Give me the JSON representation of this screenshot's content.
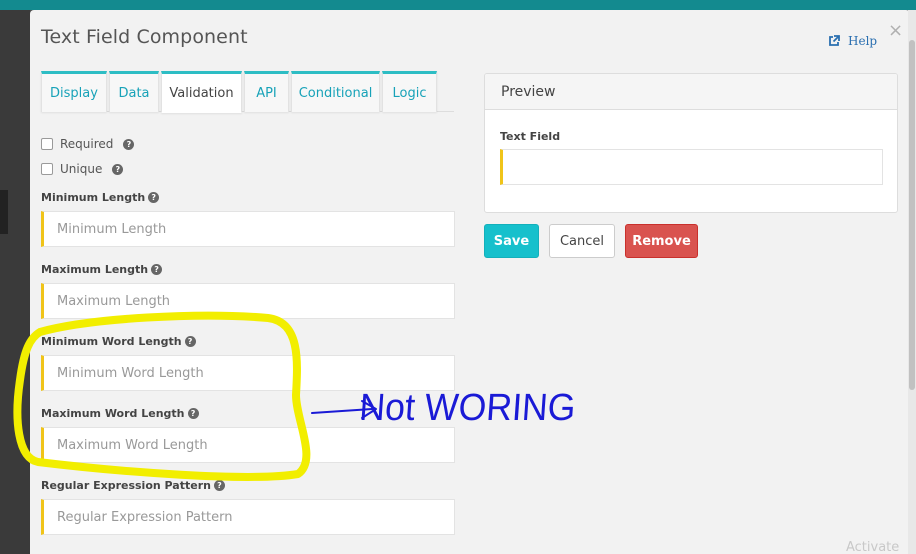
{
  "modal": {
    "title": "Text Field Component",
    "close_label": "×",
    "help_label": "Help"
  },
  "tabs": [
    {
      "label": "Display",
      "active": false
    },
    {
      "label": "Data",
      "active": false
    },
    {
      "label": "Validation",
      "active": true
    },
    {
      "label": "API",
      "active": false
    },
    {
      "label": "Conditional",
      "active": false
    },
    {
      "label": "Logic",
      "active": false
    }
  ],
  "validation": {
    "required_label": "Required",
    "unique_label": "Unique",
    "fields": [
      {
        "label": "Minimum Length",
        "placeholder": "Minimum Length"
      },
      {
        "label": "Maximum Length",
        "placeholder": "Maximum Length"
      },
      {
        "label": "Minimum Word Length",
        "placeholder": "Minimum Word Length"
      },
      {
        "label": "Maximum Word Length",
        "placeholder": "Maximum Word Length"
      },
      {
        "label": "Regular Expression Pattern",
        "placeholder": "Regular Expression Pattern"
      }
    ]
  },
  "preview": {
    "heading": "Preview",
    "field_label": "Text Field"
  },
  "actions": {
    "save": "Save",
    "cancel": "Cancel",
    "remove": "Remove"
  },
  "annotation": {
    "text": "Not WORING",
    "highlight_color": "#f2ee00",
    "ink_color": "#1a1ad6"
  },
  "colors": {
    "accent": "#16c0cc",
    "danger": "#d9534f",
    "field_marker": "#f0c419",
    "topbar": "#138a8f"
  },
  "watermark": "Activate"
}
